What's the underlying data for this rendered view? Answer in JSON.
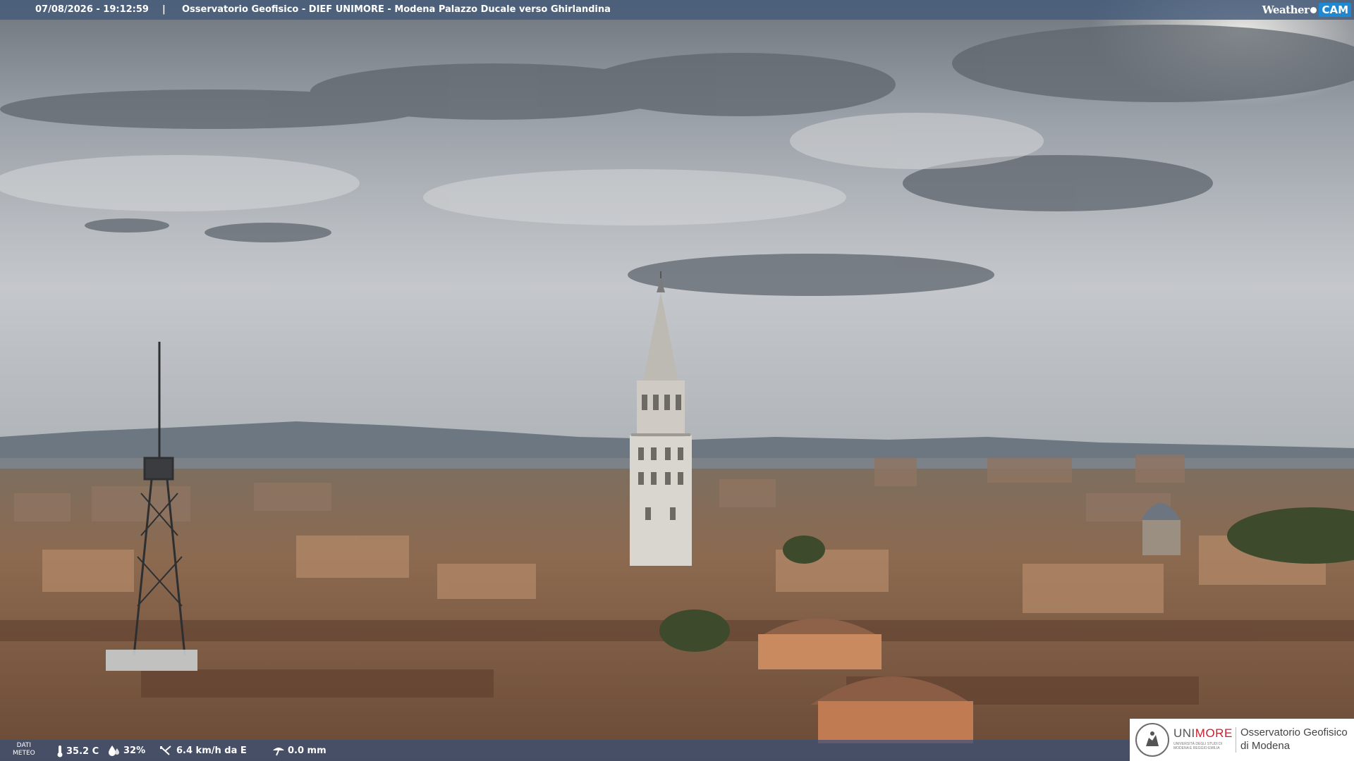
{
  "header": {
    "timestamp": "07/08/2026 - 19:12:59",
    "separator": "|",
    "title": "Osservatorio Geofisico - DIEF UNIMORE - Modena Palazzo Ducale verso Ghirlandina"
  },
  "brand": {
    "weather": "Weather",
    "cam": "CAM"
  },
  "meteo": {
    "label_line1": "DATI",
    "label_line2": "METEO",
    "temperature": "35.2 C",
    "humidity": "32%",
    "wind": "6.4 km/h da E",
    "rain": "0.0 mm",
    "icons": [
      "thermometer-icon",
      "humidity-drop-icon",
      "wind-icon",
      "rain-icon"
    ]
  },
  "logo": {
    "uni": "UNI",
    "more": "MORE",
    "subtitle": "UNIVERSITÀ DEGLI STUDI DI MODENA E REGGIO EMILIA",
    "obs_line1": "Osservatorio Geofisico",
    "obs_line2": "di Modena"
  },
  "colors": {
    "bar": "#465c7a",
    "cam": "#1e88d2",
    "unimore_red": "#c8202f"
  }
}
